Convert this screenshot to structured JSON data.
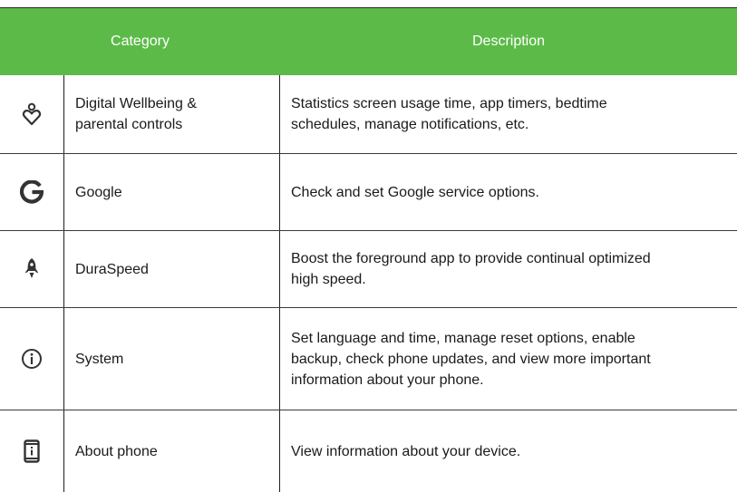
{
  "header": {
    "category_label": "Category",
    "description_label": "Description",
    "color": "#5cbb48"
  },
  "rows": [
    {
      "icon": "digital-wellbeing-icon",
      "category": "Digital Wellbeing &\nparental controls",
      "description": "Statistics screen usage time, app timers, bedtime\nschedules, manage notifications, etc."
    },
    {
      "icon": "google-icon",
      "category": "Google",
      "description": "Check and set Google service options."
    },
    {
      "icon": "rocket-icon",
      "category": "DuraSpeed",
      "description": "Boost the foreground app to provide continual optimized\nhigh speed."
    },
    {
      "icon": "info-icon",
      "category": "System",
      "description": "Set language and time, manage reset options, enable\nbackup, check phone updates, and view more important\ninformation about your phone."
    },
    {
      "icon": "phone-info-icon",
      "category": "About phone",
      "description": "View information about your device."
    }
  ]
}
